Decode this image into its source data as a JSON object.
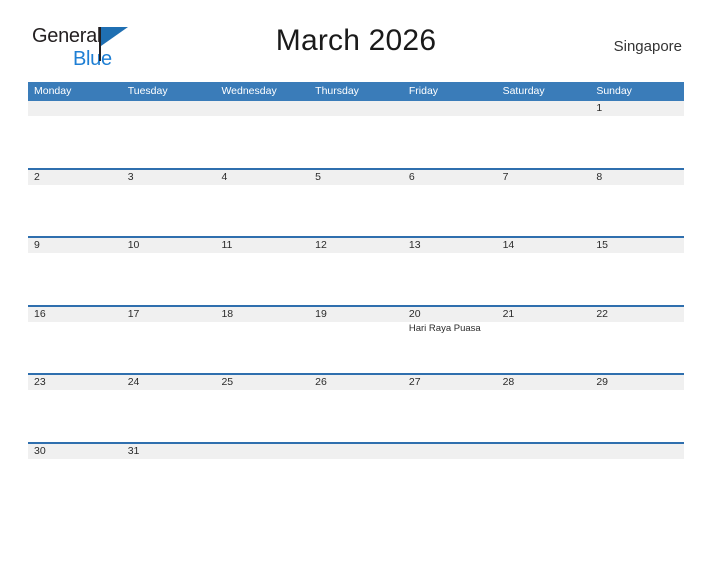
{
  "brand": {
    "name_line1": "General",
    "name_line2": "Blue",
    "flag_icon": "blue-triangle-flag-icon"
  },
  "header": {
    "title": "March 2026",
    "locale": "Singapore"
  },
  "colors": {
    "header_blue": "#3a7cb9",
    "separator_blue": "#2f6fae",
    "daynum_band_gray": "#f0f0f0",
    "brand_blue": "#1f7fd4",
    "text_dark": "#2b2b2b"
  },
  "calendar": {
    "month": "March",
    "year": "2026",
    "week_start": "Monday",
    "weekdays": [
      "Monday",
      "Tuesday",
      "Wednesday",
      "Thursday",
      "Friday",
      "Saturday",
      "Sunday"
    ],
    "weeks": [
      [
        {
          "day": "",
          "events": []
        },
        {
          "day": "",
          "events": []
        },
        {
          "day": "",
          "events": []
        },
        {
          "day": "",
          "events": []
        },
        {
          "day": "",
          "events": []
        },
        {
          "day": "",
          "events": []
        },
        {
          "day": "1",
          "events": []
        }
      ],
      [
        {
          "day": "2",
          "events": []
        },
        {
          "day": "3",
          "events": []
        },
        {
          "day": "4",
          "events": []
        },
        {
          "day": "5",
          "events": []
        },
        {
          "day": "6",
          "events": []
        },
        {
          "day": "7",
          "events": []
        },
        {
          "day": "8",
          "events": []
        }
      ],
      [
        {
          "day": "9",
          "events": []
        },
        {
          "day": "10",
          "events": []
        },
        {
          "day": "11",
          "events": []
        },
        {
          "day": "12",
          "events": []
        },
        {
          "day": "13",
          "events": []
        },
        {
          "day": "14",
          "events": []
        },
        {
          "day": "15",
          "events": []
        }
      ],
      [
        {
          "day": "16",
          "events": []
        },
        {
          "day": "17",
          "events": []
        },
        {
          "day": "18",
          "events": []
        },
        {
          "day": "19",
          "events": []
        },
        {
          "day": "20",
          "events": [
            "Hari Raya Puasa"
          ]
        },
        {
          "day": "21",
          "events": []
        },
        {
          "day": "22",
          "events": []
        }
      ],
      [
        {
          "day": "23",
          "events": []
        },
        {
          "day": "24",
          "events": []
        },
        {
          "day": "25",
          "events": []
        },
        {
          "day": "26",
          "events": []
        },
        {
          "day": "27",
          "events": []
        },
        {
          "day": "28",
          "events": []
        },
        {
          "day": "29",
          "events": []
        }
      ],
      [
        {
          "day": "30",
          "events": []
        },
        {
          "day": "31",
          "events": []
        },
        {
          "day": "",
          "events": []
        },
        {
          "day": "",
          "events": []
        },
        {
          "day": "",
          "events": []
        },
        {
          "day": "",
          "events": []
        },
        {
          "day": "",
          "events": []
        }
      ]
    ]
  }
}
